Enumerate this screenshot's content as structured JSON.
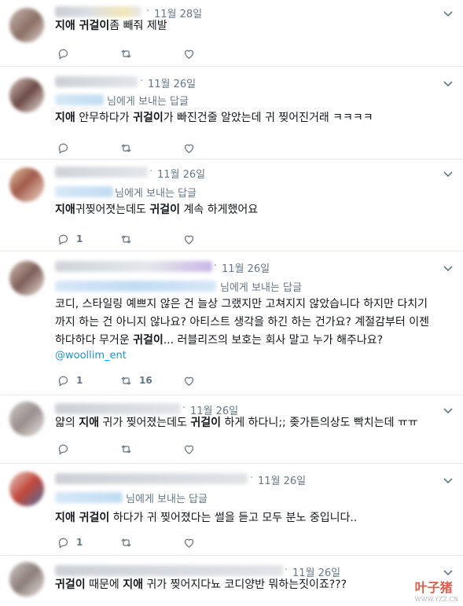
{
  "tweets": [
    {
      "date": "11월 28일",
      "reply_prefix": "",
      "segments": [
        [
          "b",
          "지애 귀걸이"
        ],
        [
          "n",
          "좀 빼줘 제발"
        ]
      ],
      "lines": null,
      "mention": "",
      "reply_count": "",
      "retweet_count": ""
    },
    {
      "date": "11월 26일",
      "reply_prefix": "님에게 보내는 답글",
      "segments": [
        [
          "b",
          "지애"
        ],
        [
          "n",
          " 안무하다가 "
        ],
        [
          "b",
          "귀걸이"
        ],
        [
          "n",
          "가 빠진건줄 알았는데 귀 찢어진거래 ㅋㅋㅋㅋ"
        ]
      ],
      "lines": null,
      "mention": "",
      "reply_count": "",
      "retweet_count": ""
    },
    {
      "date": "11월 26일",
      "reply_prefix": "님에게 보내는 답글",
      "segments": [
        [
          "b",
          "지애"
        ],
        [
          "n",
          "귀찢어졋는데도 "
        ],
        [
          "b",
          "귀걸이"
        ],
        [
          "n",
          " 계속 하게했어요"
        ]
      ],
      "lines": null,
      "mention": "",
      "reply_count": "1",
      "retweet_count": ""
    },
    {
      "date": "11월 26일",
      "reply_prefix": "님에게 보내는 답글",
      "segments": null,
      "lines": [
        [
          [
            "n",
            "코디, 스타일링 예쁘지 않은 건 늘상 그랬지만 고쳐지지 않았습니다 하지만 다치기"
          ]
        ],
        [
          [
            "n",
            "까지 하는 건 아니지 않나요? 아티스트 생각을 하긴 하는 건가요? 계절감부터 이젠"
          ]
        ],
        [
          [
            "n",
            "하다하다 무거운 "
          ],
          [
            "b",
            "귀걸이"
          ],
          [
            "n",
            "... 러블리즈의 보호는 회사 말고 누가 해주나요?"
          ]
        ]
      ],
      "mention": "@woollim_ent",
      "reply_count": "1",
      "retweet_count": "16"
    },
    {
      "date": "11월 26일",
      "reply_prefix": "",
      "segments": [
        [
          "n",
          "얇의 "
        ],
        [
          "b",
          "지애"
        ],
        [
          "n",
          " 귀가 찢어졌는데도 "
        ],
        [
          "b",
          "귀걸이"
        ],
        [
          "n",
          " 하게 하다니;; 좆가튼의상도 빡치는데 ㅠㅠ"
        ]
      ],
      "lines": null,
      "mention": "",
      "reply_count": "",
      "retweet_count": ""
    },
    {
      "date": "11월 26일",
      "reply_prefix": "님에게 보내는 답글",
      "segments": [
        [
          "b",
          "지애 귀걸이"
        ],
        [
          "n",
          " 하다가 귀 찢어졌다는 썰을 듣고 모두 분노 중입니다.."
        ]
      ],
      "lines": null,
      "mention": "",
      "reply_count": "1",
      "retweet_count": ""
    },
    {
      "date": "11월 26일",
      "reply_prefix": "",
      "segments": [
        [
          "b",
          "귀걸이"
        ],
        [
          "n",
          " 때문에 "
        ],
        [
          "b",
          "지애"
        ],
        [
          "n",
          " 귀가 찢어지다뇨 코디양반 뭐하는짓이죠???"
        ]
      ],
      "lines": null,
      "mention": "",
      "reply_count": "",
      "retweet_count": ""
    }
  ],
  "watermark": {
    "brand": "叶子猪",
    "sub": "WWW.YZZ.CN"
  },
  "icons": [
    "reply-icon",
    "retweet-icon",
    "like-icon",
    "chevron-down-icon"
  ]
}
